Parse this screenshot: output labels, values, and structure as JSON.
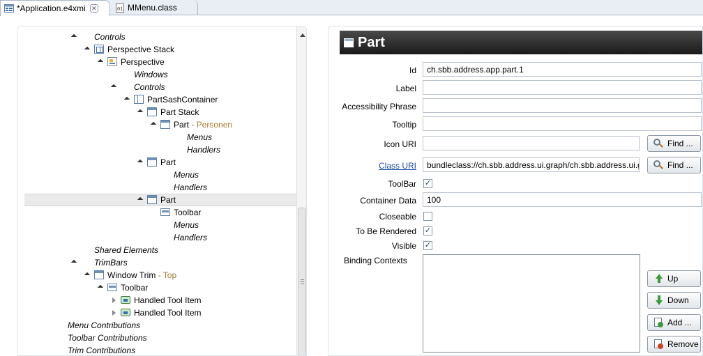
{
  "tabs": [
    {
      "label": "*Application.e4xmi",
      "icon": "e4xmi-file-icon",
      "active": true,
      "close": "✕"
    },
    {
      "label": "MMenu.class",
      "icon": "class-file-icon",
      "active": false
    }
  ],
  "tree": {
    "rows": [
      {
        "label": "Controls",
        "italic": true
      },
      {
        "label": "Perspective Stack",
        "icon": "perspective-stack-icon"
      },
      {
        "label": "Perspective",
        "icon": "perspective-icon"
      },
      {
        "label": "Windows",
        "italic": true
      },
      {
        "label": "Controls",
        "italic": true
      },
      {
        "label": "PartSashContainer",
        "icon": "sash-container-icon"
      },
      {
        "label": "Part Stack",
        "icon": "part-stack-icon"
      },
      {
        "label": "Part",
        "sub": " - Personen",
        "icon": "part-icon"
      },
      {
        "label": "Menus",
        "italic": true
      },
      {
        "label": "Handlers",
        "italic": true
      },
      {
        "label": "Part",
        "icon": "part-icon"
      },
      {
        "label": "Menus",
        "italic": true
      },
      {
        "label": "Handlers",
        "italic": true
      },
      {
        "label": "Part",
        "icon": "part-icon",
        "selected": true
      },
      {
        "label": "Toolbar",
        "icon": "toolbar-icon"
      },
      {
        "label": "Menus",
        "italic": true
      },
      {
        "label": "Handlers",
        "italic": true
      },
      {
        "label": "Shared Elements",
        "italic": true
      },
      {
        "label": "TrimBars",
        "italic": true
      },
      {
        "label": "Window Trim",
        "sub": " - Top",
        "icon": "window-trim-icon"
      },
      {
        "label": "Toolbar",
        "icon": "toolbar-icon"
      },
      {
        "label": "Handled Tool Item",
        "icon": "handled-tool-item-icon"
      },
      {
        "label": "Handled Tool Item",
        "icon": "handled-tool-item-icon"
      },
      {
        "label": "Menu Contributions",
        "italic": true
      },
      {
        "label": "Toolbar Contributions",
        "italic": true
      },
      {
        "label": "Trim Contributions",
        "italic": true
      }
    ]
  },
  "editor": {
    "title": "Part",
    "fields": {
      "id": {
        "label": "Id",
        "value": "ch.sbb.address.app.part.1"
      },
      "label": {
        "label": "Label",
        "value": ""
      },
      "accessibility": {
        "label": "Accessibility Phrase",
        "value": ""
      },
      "tooltip": {
        "label": "Tooltip",
        "value": ""
      },
      "icon_uri": {
        "label": "Icon URI",
        "value": ""
      },
      "class_uri": {
        "label": "Class URI",
        "value": "bundleclass://ch.sbb.address.ui.graph/ch.sbb.address.ui.graph.AddressGraph"
      },
      "toolbar": {
        "label": "ToolBar",
        "checked": true
      },
      "container_data": {
        "label": "Container Data",
        "value": "100"
      },
      "closeable": {
        "label": "Closeable",
        "checked": false
      },
      "to_be_rendered": {
        "label": "To Be Rendered",
        "checked": true
      },
      "visible": {
        "label": "Visible",
        "checked": true
      },
      "binding_contexts": {
        "label": "Binding Contexts"
      }
    },
    "buttons": {
      "find": "Find ...",
      "up": "Up",
      "down": "Down",
      "add": "Add ...",
      "remove": "Remove"
    },
    "check_glyph": "✓"
  }
}
